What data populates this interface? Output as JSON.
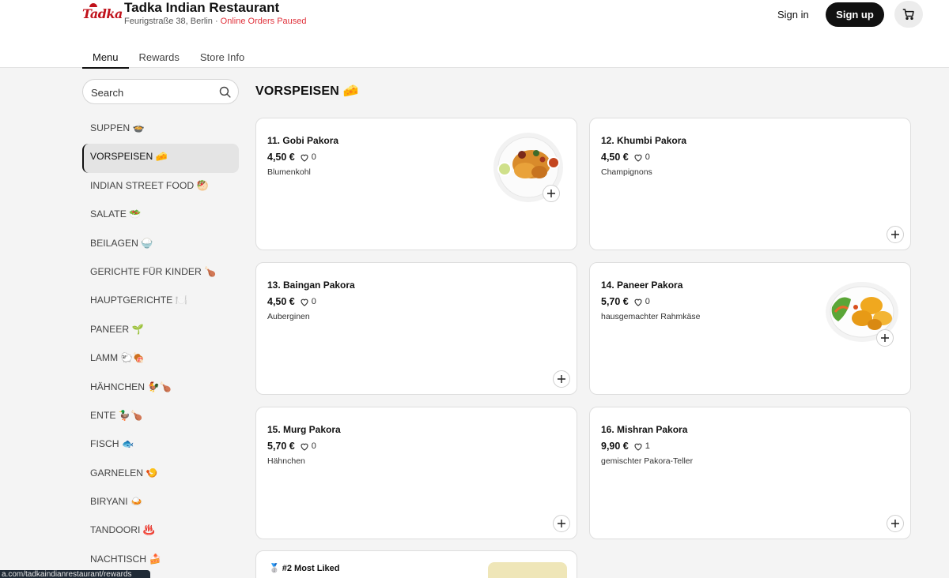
{
  "header": {
    "logo_text": "Tadka",
    "restaurant_name": "Tadka Indian Restaurant",
    "address": "Feurigstraße 38, Berlin",
    "separator": " · ",
    "order_status": "Online Orders Paused",
    "sign_in": "Sign in",
    "sign_up": "Sign up",
    "cart_icon": "cart-icon"
  },
  "tabs": [
    {
      "label": "Menu",
      "active": true
    },
    {
      "label": "Rewards",
      "active": false
    },
    {
      "label": "Store Info",
      "active": false
    }
  ],
  "search": {
    "placeholder": "Search",
    "icon": "search-icon"
  },
  "categories": [
    {
      "label": "SUPPEN 🍲"
    },
    {
      "label": "VORSPEISEN 🧀",
      "active": true
    },
    {
      "label": "INDIAN STREET FOOD 🥙"
    },
    {
      "label": "SALATE 🥗"
    },
    {
      "label": "BEILAGEN 🍚"
    },
    {
      "label": "GERICHTE FÜR KINDER 🍗"
    },
    {
      "label": "HAUPTGERICHTE 🍽️"
    },
    {
      "label": "PANEER 🌱"
    },
    {
      "label": "LAMM 🐑🍖"
    },
    {
      "label": "HÄHNCHEN 🐓🍗"
    },
    {
      "label": "ENTE 🦆🍗"
    },
    {
      "label": "FISCH 🐟"
    },
    {
      "label": "GARNELEN 🍤"
    },
    {
      "label": "BIRYANI 🍛"
    },
    {
      "label": "TANDOORI ♨️"
    },
    {
      "label": "NACHTISCH 🍰"
    }
  ],
  "section": {
    "title": "VORSPEISEN 🧀"
  },
  "items": [
    {
      "name": "11. Gobi Pakora",
      "price": "4,50 €",
      "likes": "0",
      "description": "Blumenkohl",
      "has_photo": true
    },
    {
      "name": "12. Khumbi Pakora",
      "price": "4,50 €",
      "likes": "0",
      "description": "Champignons",
      "has_photo": false
    },
    {
      "name": "13. Baingan Pakora",
      "price": "4,50 €",
      "likes": "0",
      "description": "Auberginen",
      "has_photo": false
    },
    {
      "name": "14. Paneer Pakora",
      "price": "5,70 €",
      "likes": "0",
      "description": "hausgemachter Rahmkäse",
      "has_photo": true
    },
    {
      "name": "15. Murg Pakora",
      "price": "5,70 €",
      "likes": "0",
      "description": "Hähnchen",
      "has_photo": false
    },
    {
      "name": "16. Mishran Pakora",
      "price": "9,90 €",
      "likes": "1",
      "description": "gemischter Pakora-Teller",
      "has_photo": false
    }
  ],
  "next_card": {
    "badge": "🥈 #2 Most Liked"
  },
  "status_bar": {
    "url": "a.com/tadkaindianrestaurant/rewards"
  },
  "colors": {
    "accent": "#111111",
    "brand": "#c0121b",
    "warning": "#e0323b",
    "background": "#f4f4f4"
  }
}
